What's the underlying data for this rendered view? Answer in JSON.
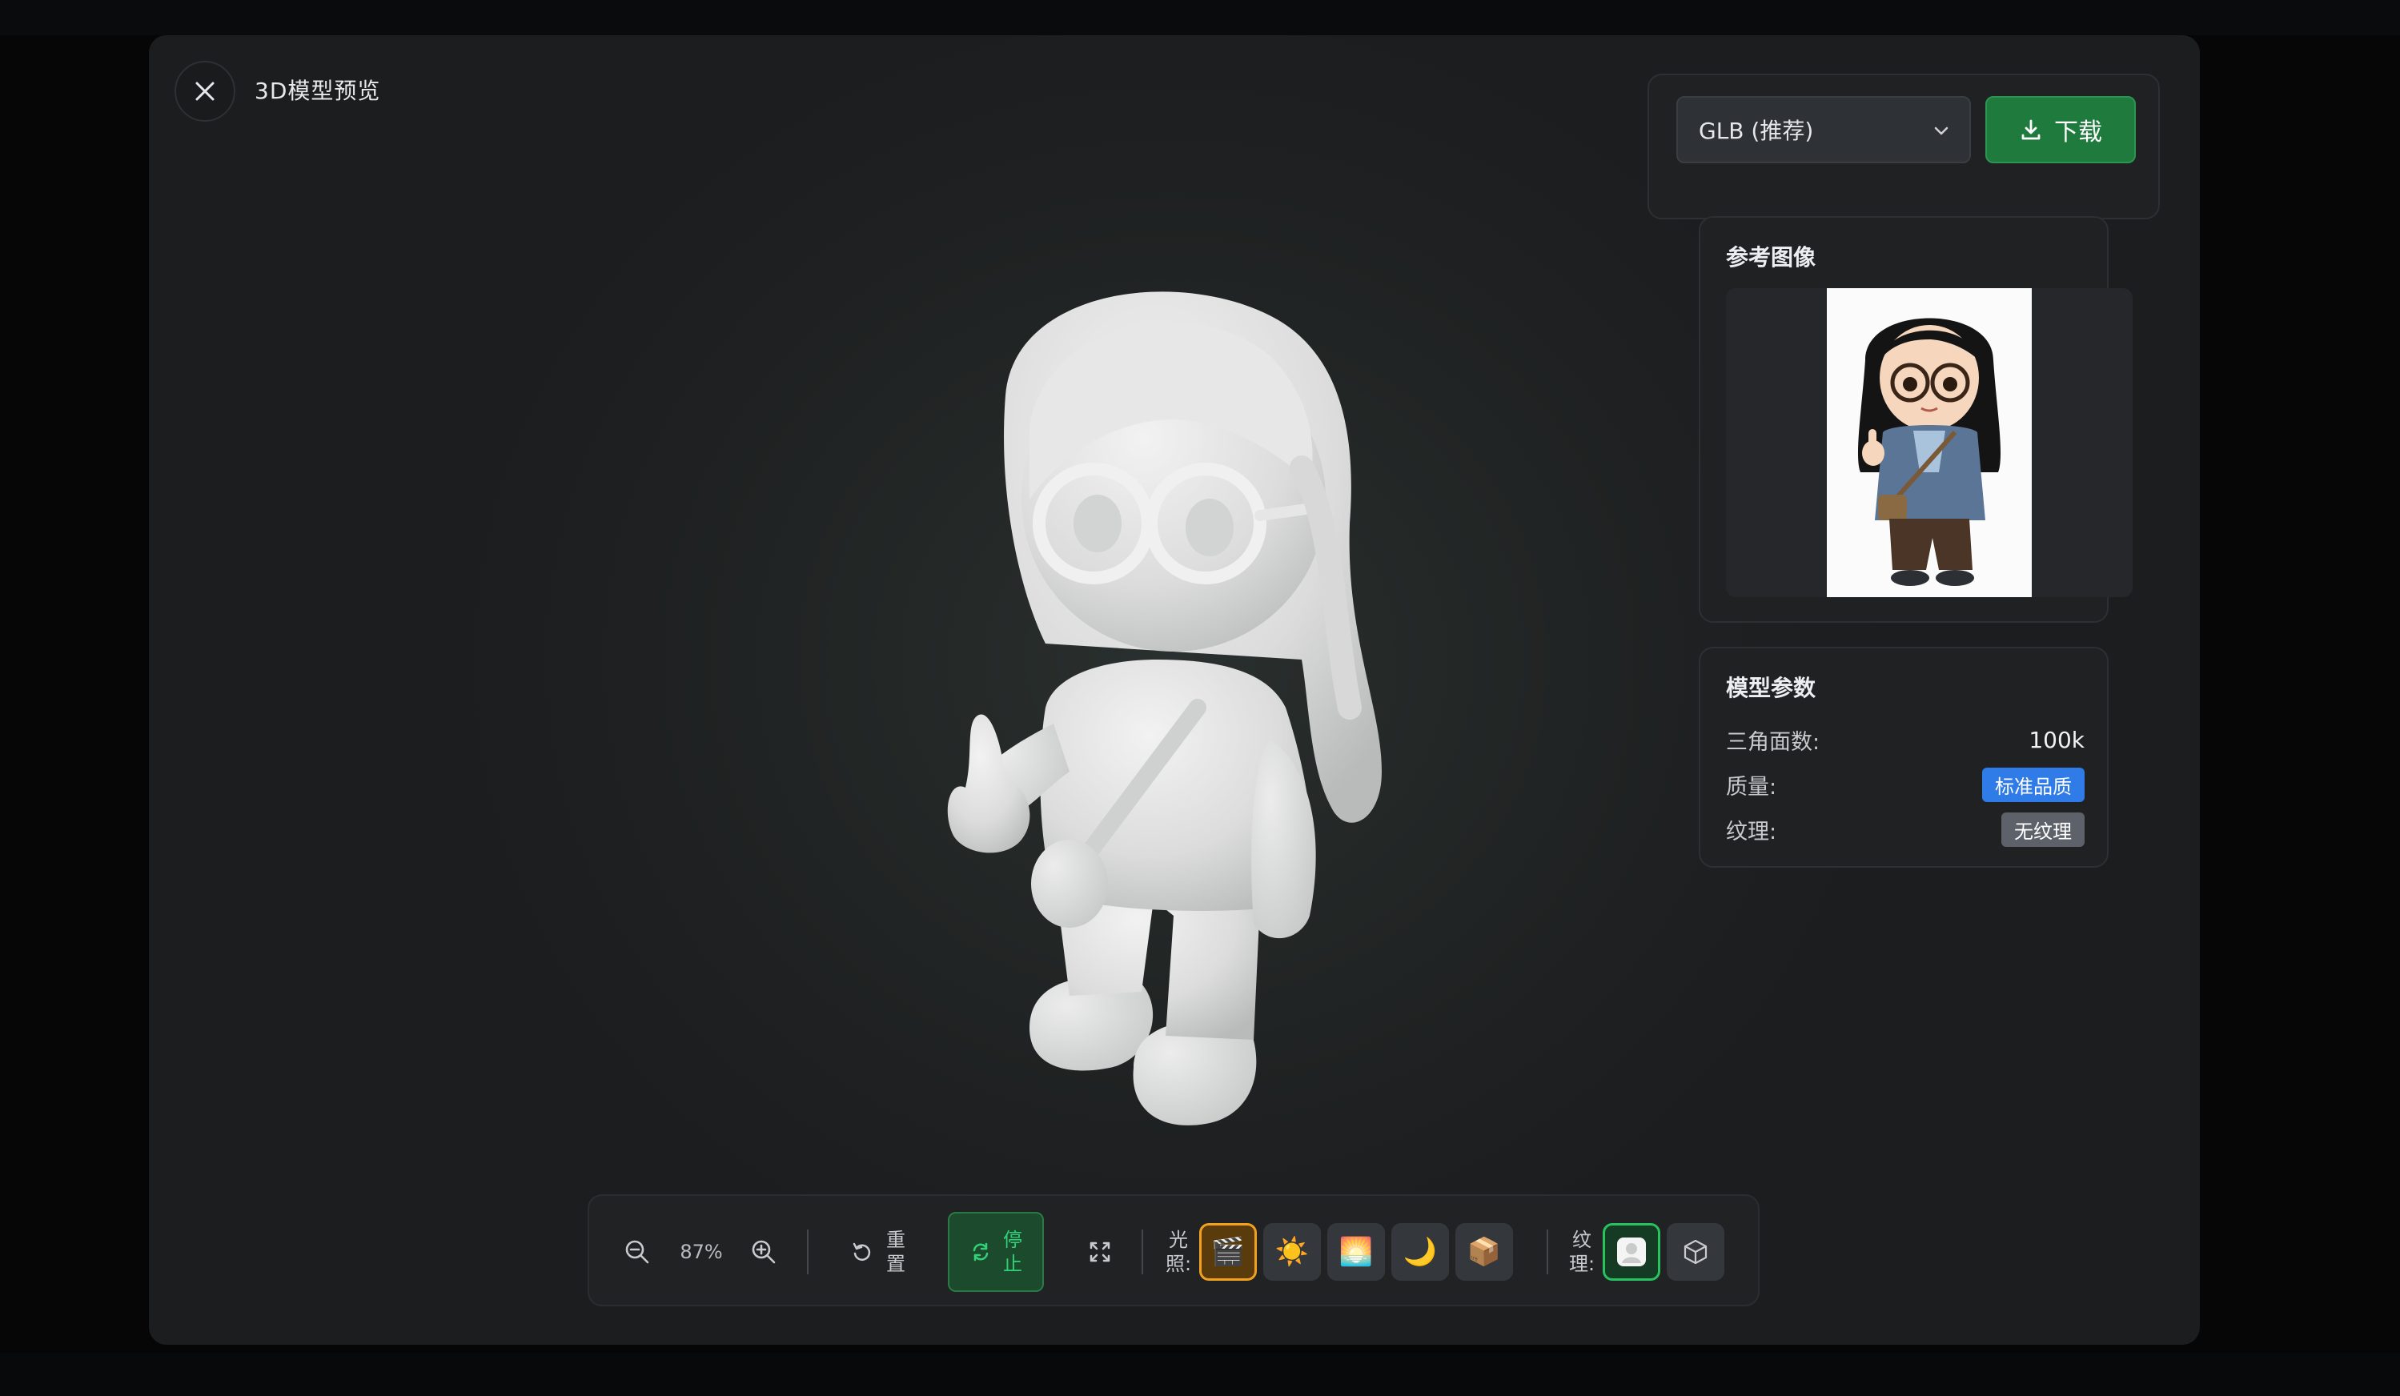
{
  "header": {
    "title": "3D模型预览"
  },
  "download": {
    "format_selected": "GLB (推荐)",
    "button_label": "下载"
  },
  "reference": {
    "title": "参考图像"
  },
  "params": {
    "title": "模型参数",
    "rows": [
      {
        "label": "三角面数:",
        "value": "100k"
      },
      {
        "label": "质量:",
        "value": "标准品质"
      },
      {
        "label": "纹理:",
        "value": "无纹理"
      }
    ]
  },
  "toolbar": {
    "zoom_level": "87%",
    "reset_label_1": "重",
    "reset_label_2": "置",
    "stop_label_1": "停",
    "stop_label_2": "止",
    "lighting_label_1": "光",
    "lighting_label_2": "照:",
    "texture_label_1": "纹",
    "texture_label_2": "理:",
    "lighting_options": [
      "🎬",
      "☀️",
      "🌅",
      "🌙",
      "📦"
    ],
    "active_lighting": 0
  },
  "colors": {
    "accent_green": "#1f7a3d",
    "active_orange": "#f2a11e",
    "badge_blue": "#2f7be8",
    "badge_grey": "#5d626a"
  }
}
